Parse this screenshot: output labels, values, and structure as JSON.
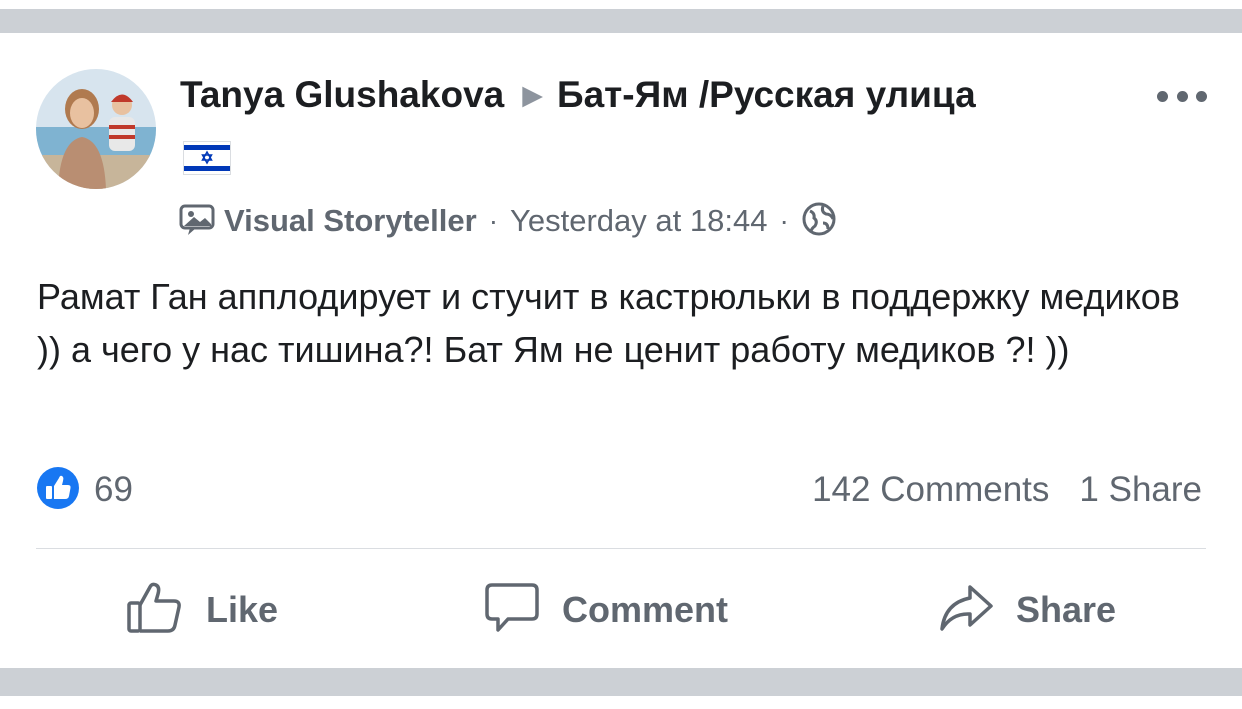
{
  "post": {
    "author": "Tanya Glushakova",
    "group": "Бат-Ям /Русская улица",
    "badge": "Visual Storyteller",
    "timestamp": "Yesterday at 18:44",
    "privacy_icon": "globe-icon",
    "text": "Рамат Ган апплодирует и стучит в кастрюльки в поддержку медиков )) а чего у нас тишина?! Бат Ям не ценит работу медиков ?! ))"
  },
  "stats": {
    "reaction_icon": "like-reaction-icon",
    "reactions": "69",
    "comments": "142 Comments",
    "shares": "1 Share"
  },
  "actions": {
    "like": "Like",
    "comment": "Comment",
    "share": "Share"
  },
  "colors": {
    "divider": "#ccd0d5",
    "secondary_text": "#606770",
    "primary_text": "#1c1e21",
    "like_blue": "#1877f2",
    "flag_blue": "#0038b8"
  }
}
